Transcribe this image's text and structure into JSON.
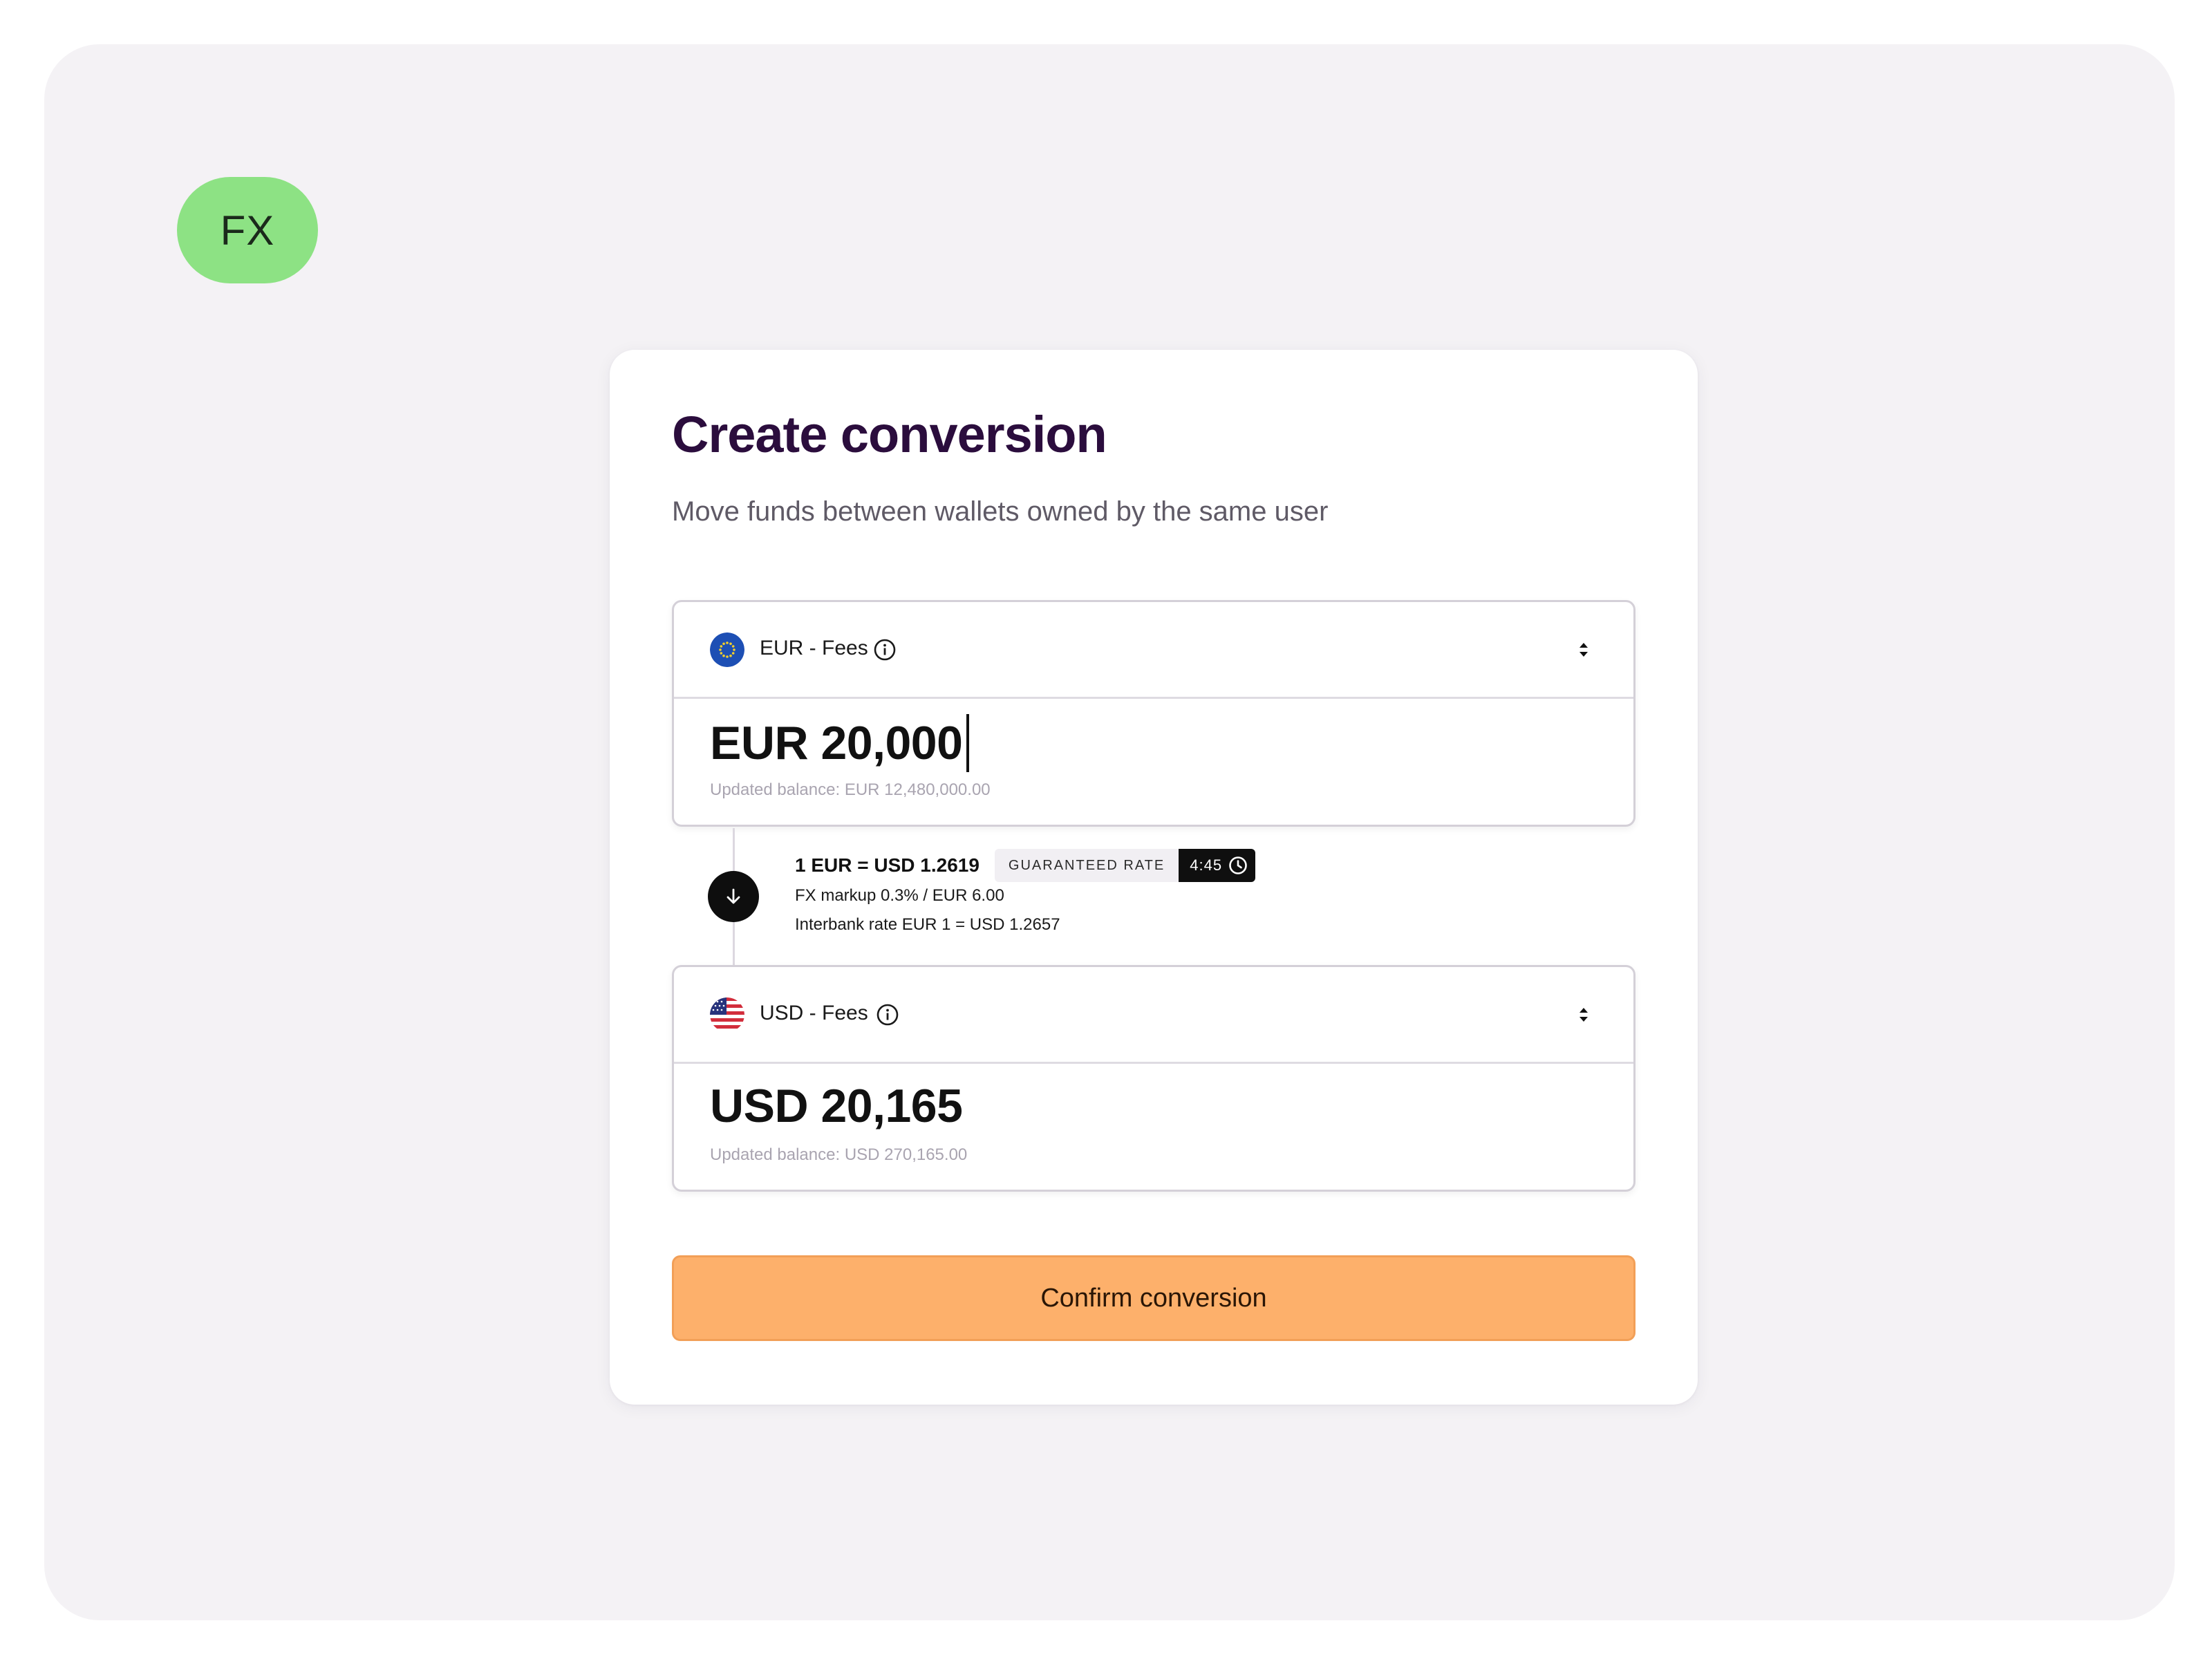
{
  "logo": {
    "text": "FX"
  },
  "form": {
    "title": "Create conversion",
    "subtitle": "Move funds between wallets owned by the same user"
  },
  "from_wallet": {
    "flag_icon": "eu-flag-icon",
    "name": "EUR - Fees",
    "amount": "EUR 20,000",
    "updated_balance": "Updated balance: EUR 12,480,000.00"
  },
  "rate": {
    "label": "1 EUR = USD 1.2619",
    "guaranteed_label": "GUARANTEED RATE",
    "timer": "4:45",
    "markup": "FX markup 0.3% / EUR 6.00",
    "interbank": "Interbank rate EUR 1 = USD 1.2657"
  },
  "to_wallet": {
    "flag_icon": "us-flag-icon",
    "name": "USD - Fees",
    "amount": "USD 20,165",
    "updated_balance": "Updated balance: USD 270,165.00"
  },
  "actions": {
    "confirm_label": "Confirm conversion"
  },
  "colors": {
    "background": "#f4f2f5",
    "logo_bg": "#8de284",
    "title": "#2b0d3d",
    "confirm_bg": "#fdb06b"
  }
}
